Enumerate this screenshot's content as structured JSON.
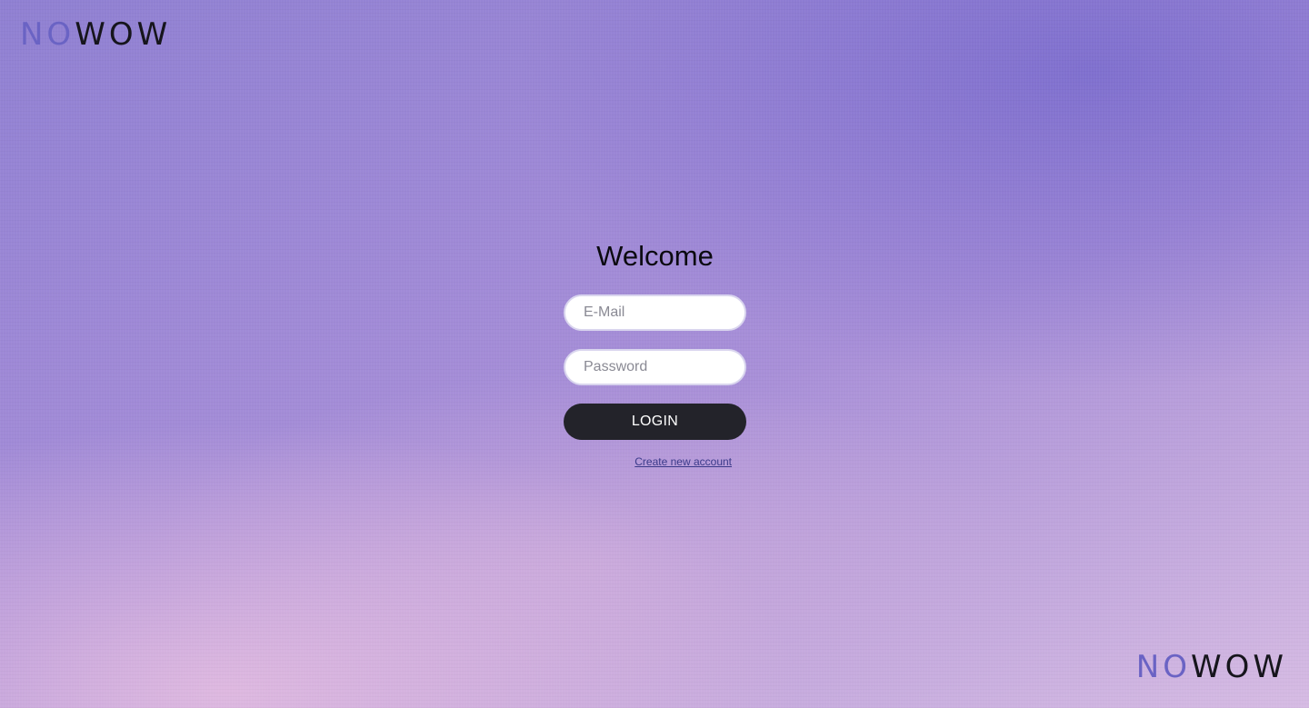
{
  "brand": {
    "logo_part_a": "NO",
    "logo_part_b": "WOW",
    "accent_color": "#6a63c4",
    "dark_color": "#16151c"
  },
  "login": {
    "title": "Welcome",
    "email_placeholder": "E-Mail",
    "email_value": "",
    "password_placeholder": "Password",
    "password_value": "",
    "login_button_label": "LOGIN",
    "create_account_label": "Create new account",
    "button_color": "#23232a"
  }
}
